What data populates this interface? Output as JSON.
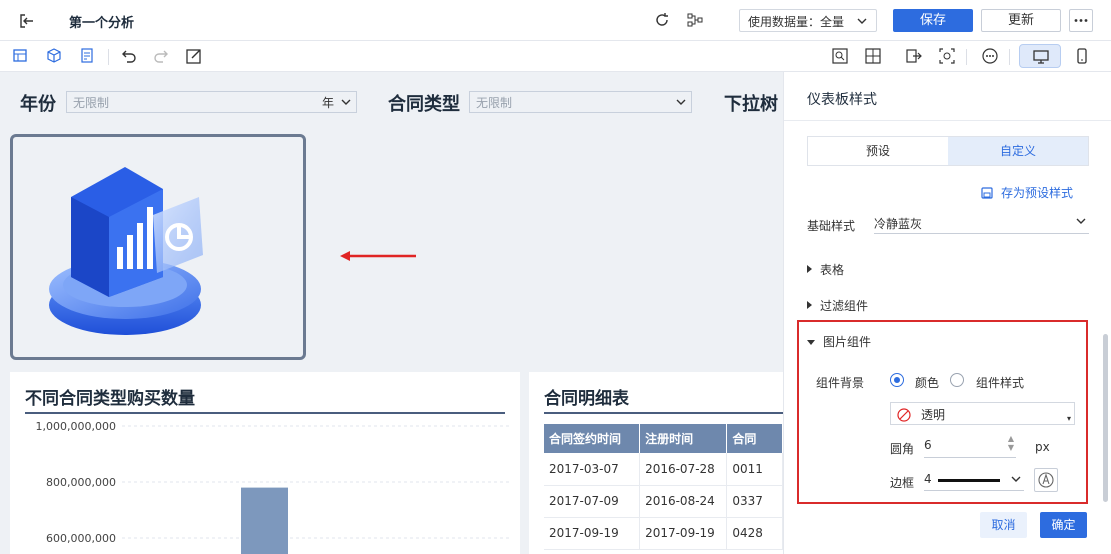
{
  "topbar": {
    "title": "第一个分析",
    "data_amount": "使用数据量：全量",
    "save": "保存",
    "update": "更新"
  },
  "filters": [
    {
      "label": "年份",
      "placeholder": "无限制",
      "suffix": "年"
    },
    {
      "label": "合同类型",
      "placeholder": "无限制"
    },
    {
      "label": "下拉树"
    }
  ],
  "bar_card": {
    "title": "不同合同类型购买数量",
    "y_ticks": [
      "1,000,000,000",
      "800,000,000",
      "600,000,000"
    ]
  },
  "chart_data": {
    "type": "bar",
    "title": "不同合同类型购买数量",
    "ylim": [
      600000000,
      1000000000
    ],
    "y_ticks": [
      1000000000,
      800000000,
      600000000
    ],
    "values": [
      780000000
    ]
  },
  "detail_card": {
    "title": "合同明细表",
    "columns": [
      "合同签约时间",
      "注册时间",
      "合同"
    ],
    "rows": [
      [
        "2017-03-07",
        "2016-07-28",
        "0011"
      ],
      [
        "2017-07-09",
        "2016-08-24",
        "0337"
      ],
      [
        "2017-09-19",
        "2017-09-19",
        "0428"
      ]
    ]
  },
  "panel": {
    "title": "仪表板样式",
    "tabs": [
      "预设",
      "自定义"
    ],
    "save_preset": "存为预设样式",
    "base_style_label": "基础样式",
    "base_style_value": "冷静蓝灰",
    "sections": [
      "表格",
      "过滤组件",
      "图片组件"
    ],
    "bg_label": "组件背景",
    "radio_color": "颜色",
    "radio_style": "组件样式",
    "color_value": "透明",
    "radius_label": "圆角",
    "radius_value": "6",
    "radius_unit": "px",
    "border_label": "边框",
    "border_value": "4",
    "cancel": "取消",
    "ok": "确定"
  },
  "colors": {
    "accent": "#2d6cdf",
    "highlight": "#d92b2b",
    "bar": "#7d98bd",
    "table_header": "#6e88ad"
  }
}
